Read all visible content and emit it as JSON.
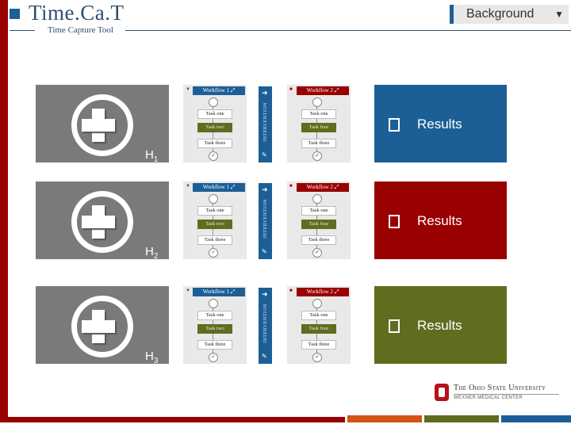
{
  "header": {
    "app_title": "Time.Ca.T",
    "subtitle": "Time Capture Tool"
  },
  "dropdown": {
    "selected": "Background",
    "caret": "▼"
  },
  "rows": [
    {
      "hypothesis": "H",
      "hypothesis_sub": "1",
      "workflow1": {
        "title": "Workflow 1",
        "tasks": [
          "Task one",
          "Task two",
          "Task three"
        ],
        "active_index": 1
      },
      "intervention_label": "INTERVENTION",
      "workflow2": {
        "title": "Workflow 2",
        "tasks": [
          "Task one",
          "Task four",
          "Task three"
        ],
        "active_index": 1
      },
      "result_label": "Results",
      "result_color": "#1c5f96"
    },
    {
      "hypothesis": "H",
      "hypothesis_sub": "2",
      "workflow1": {
        "title": "Workflow 1",
        "tasks": [
          "Task one",
          "Task two",
          "Task three"
        ],
        "active_index": 1
      },
      "intervention_label": "INTERVENTION",
      "workflow2": {
        "title": "Workflow 2",
        "tasks": [
          "Task one",
          "Task four",
          "Task three"
        ],
        "active_index": 1
      },
      "result_label": "Results",
      "result_color": "#990000"
    },
    {
      "hypothesis": "H",
      "hypothesis_sub": "3",
      "workflow1": {
        "title": "Workflow 1",
        "tasks": [
          "Task one",
          "Task two",
          "Task three"
        ],
        "active_index": 1
      },
      "intervention_label": "INTERVENTION",
      "workflow2": {
        "title": "Workflow 2",
        "tasks": [
          "Task one",
          "Task four",
          "Task three"
        ],
        "active_index": 1
      },
      "result_label": "Results",
      "result_color": "#5f6d1e"
    }
  ],
  "colors": {
    "brand_red": "#990000",
    "brand_blue": "#1c5f96",
    "brand_green": "#5f6d1e",
    "brand_orange": "#d35318",
    "tile_gray": "#7a7a7a"
  },
  "footer": {
    "university": "The Ohio State University",
    "center": "WEXNER MEDICAL CENTER"
  }
}
